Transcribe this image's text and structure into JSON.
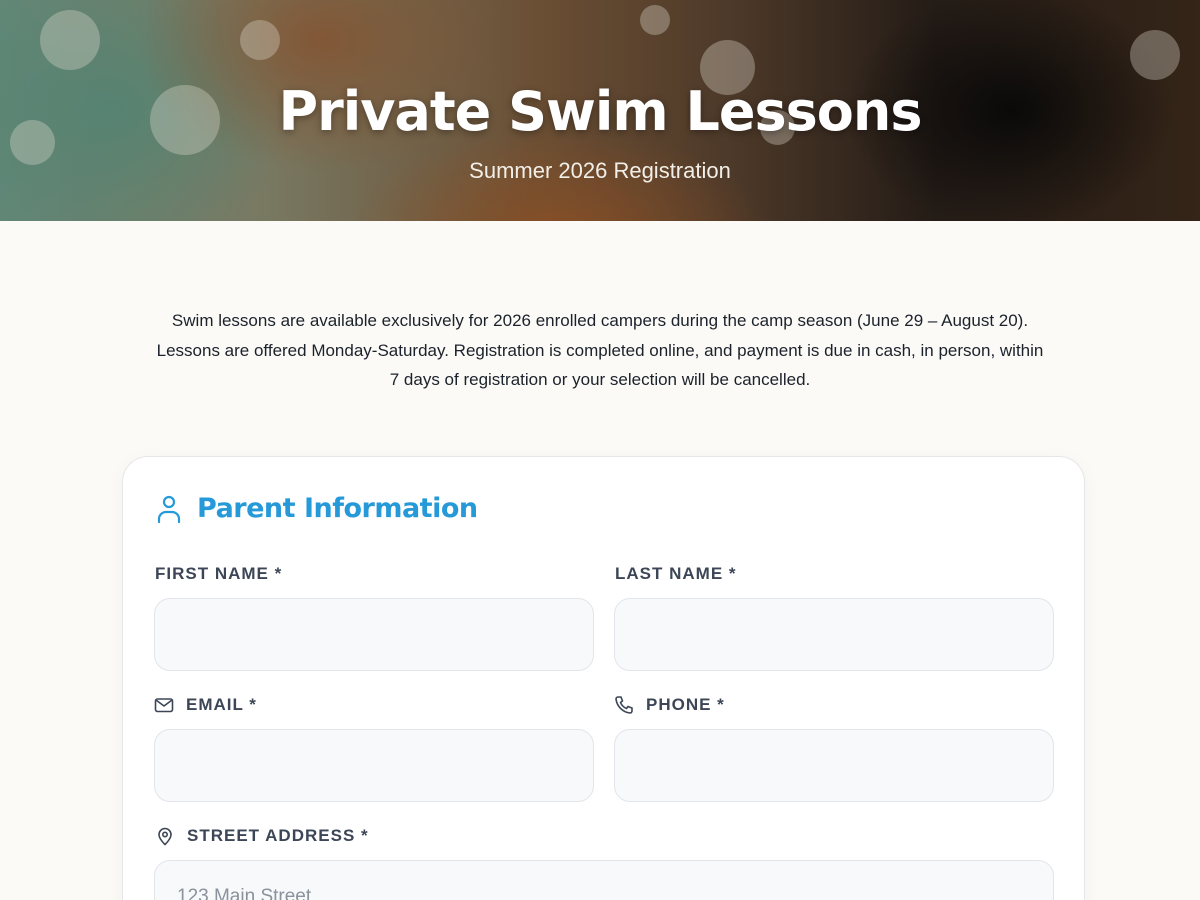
{
  "hero": {
    "title": "Private Swim Lessons",
    "subtitle": "Summer 2026 Registration"
  },
  "intro": {
    "text": "Swim lessons are available exclusively for 2026 enrolled campers during the camp season (June 29 – August 20). Lessons are offered Monday-Saturday. Registration is completed online, and payment is due in cash, in person, within 7 days of registration or your selection will be cancelled."
  },
  "parent_section": {
    "title": "Parent Information",
    "icon": "user-icon",
    "fields": {
      "first_name": {
        "label": "FIRST NAME *",
        "value": "",
        "placeholder": ""
      },
      "last_name": {
        "label": "LAST NAME *",
        "value": "",
        "placeholder": ""
      },
      "email": {
        "label": "EMAIL *",
        "icon": "mail-icon",
        "value": "",
        "placeholder": ""
      },
      "phone": {
        "label": "PHONE *",
        "icon": "phone-icon",
        "value": "",
        "placeholder": ""
      },
      "street": {
        "label": "STREET ADDRESS *",
        "icon": "map-pin-icon",
        "value": "",
        "placeholder": "123 Main Street"
      }
    }
  },
  "colors": {
    "accent": "#2699d8",
    "page_background": "#fbfaf6",
    "label": "#3c4656"
  }
}
